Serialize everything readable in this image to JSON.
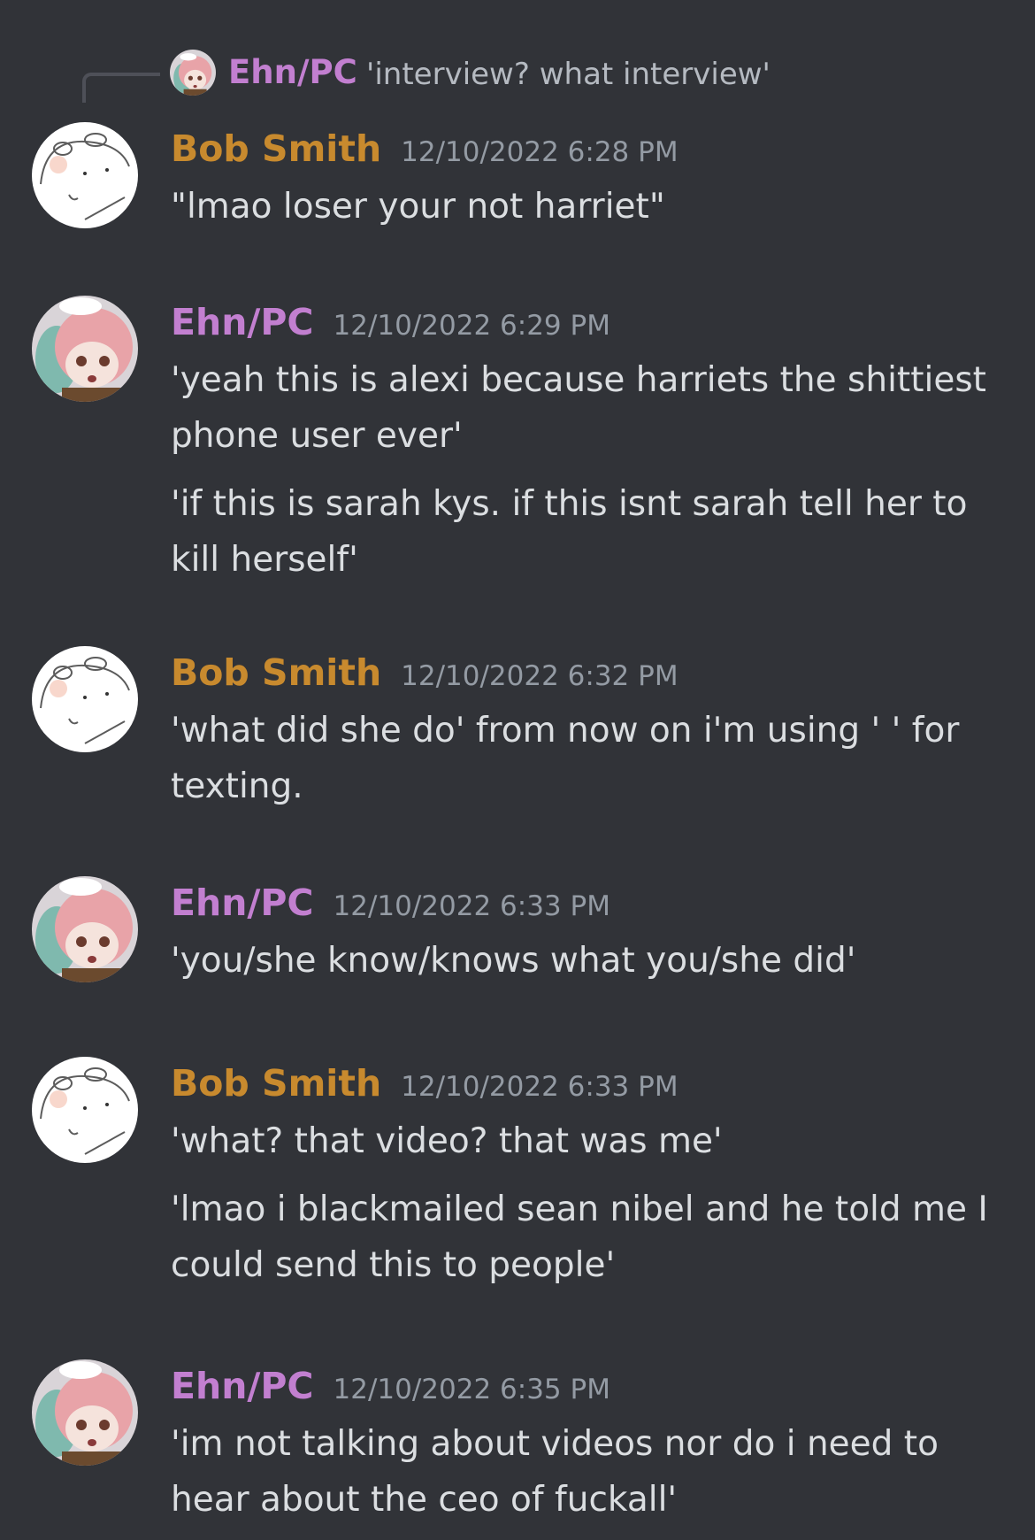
{
  "reply": {
    "author": "Ehn/PC",
    "text": "'interview? what interview'"
  },
  "messages": [
    {
      "author": "Bob Smith",
      "timestamp": "12/10/2022 6:28 PM",
      "lines": [
        "\"lmao loser your not harriet\""
      ]
    },
    {
      "author": "Ehn/PC",
      "timestamp": "12/10/2022 6:29 PM",
      "lines": [
        "'yeah this is alexi because harriets the shittiest phone user ever'",
        "'if this is sarah kys. if this isnt sarah tell her to kill herself'"
      ]
    },
    {
      "author": "Bob Smith",
      "timestamp": "12/10/2022 6:32 PM",
      "lines": [
        "'what did she do' from now on i'm using ' ' for texting."
      ]
    },
    {
      "author": "Ehn/PC",
      "timestamp": "12/10/2022 6:33 PM",
      "lines": [
        "'you/she know/knows what you/she did'"
      ]
    },
    {
      "author": "Bob Smith",
      "timestamp": "12/10/2022 6:33 PM",
      "lines": [
        "'what? that video? that was me'",
        "'lmao i blackmailed sean nibel and he told me I could send this to people'"
      ]
    },
    {
      "author": "Ehn/PC",
      "timestamp": "12/10/2022 6:35 PM",
      "lines": [
        "'im not talking about videos nor do i need to hear about the ceo of fuckall'"
      ]
    }
  ],
  "colors": {
    "background": "#313338",
    "bob_name": "#c88a2e",
    "ehn_name": "#c27fd0",
    "timestamp": "#949ba4",
    "message_text": "#dbdee1"
  }
}
